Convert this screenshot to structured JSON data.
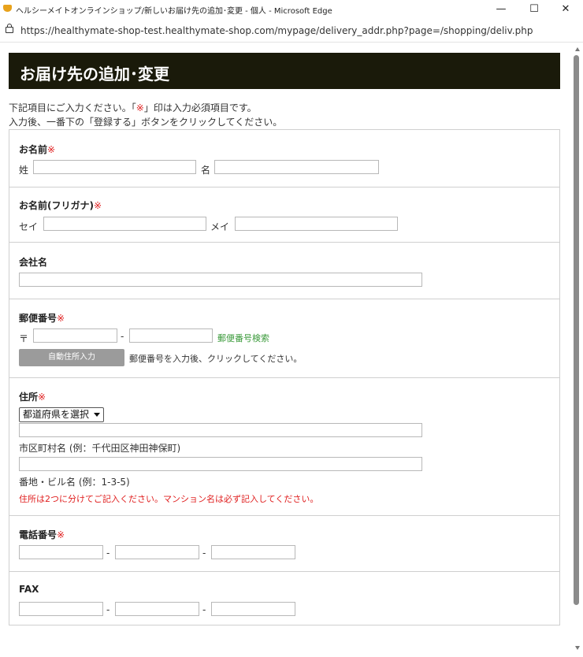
{
  "window": {
    "title": "ヘルシーメイトオンラインショップ/新しいお届け先の追加･変更 - 個人 - Microsoft Edge",
    "url": "https://healthymate-shop-test.healthymate-shop.com/mypage/delivery_addr.php?page=/shopping/deliv.php",
    "minimize": "—",
    "maximize": "☐",
    "close": "✕"
  },
  "page": {
    "heading": "お届け先の追加･変更",
    "intro_line1_a": "下記項目にご入力ください。「",
    "intro_mark": "※",
    "intro_line1_b": "」印は入力必須項目です。",
    "intro_line2": "入力後、一番下の「登録する」ボタンをクリックしてください。"
  },
  "required_mark": "※",
  "form": {
    "name": {
      "label": "お名前",
      "sei_label": "姓",
      "mei_label": "名",
      "sei_value": "",
      "mei_value": ""
    },
    "kana": {
      "label": "お名前(フリガナ)",
      "sei_label": "セイ",
      "mei_label": "メイ",
      "sei_value": "",
      "mei_value": ""
    },
    "company": {
      "label": "会社名",
      "value": ""
    },
    "zip": {
      "label": "郵便番号",
      "prefix": "〒",
      "separator": "-",
      "search_link": "郵便番号検索",
      "auto_button": "自動住所入力",
      "auto_hint": "郵便番号を入力後、クリックしてください。",
      "zip1": "",
      "zip2": ""
    },
    "address": {
      "label": "住所",
      "pref_selected": "都道府県を選択",
      "addr1_hint": "市区町村名 (例：千代田区神田神保町)",
      "addr2_hint": "番地・ビル名 (例：1-3-5)",
      "note": "住所は2つに分けてご記入ください。マンション名は必ず記入してください。",
      "addr1": "",
      "addr2": ""
    },
    "tel": {
      "label": "電話番号",
      "separator": "-",
      "tel1": "",
      "tel2": "",
      "tel3": ""
    },
    "fax": {
      "label": "FAX",
      "separator": "-",
      "fax1": "",
      "fax2": "",
      "fax3": ""
    }
  },
  "colors": {
    "header_bg": "#1a1a0a",
    "required": "#e02020",
    "link": "#3a9a3a",
    "button": "#9b9b9b"
  },
  "icons": {
    "app": "browser-app-icon",
    "lock": "lock-icon"
  }
}
